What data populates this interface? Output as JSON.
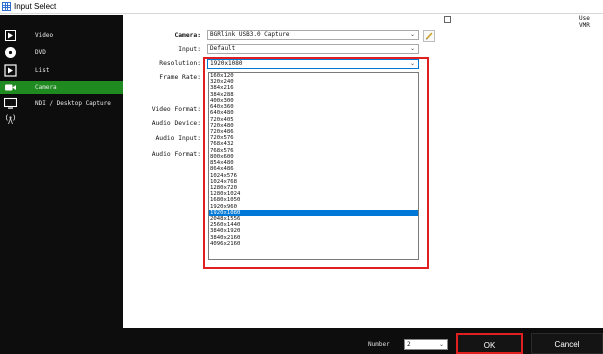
{
  "window": {
    "title": "Input Select"
  },
  "sidebar": {
    "items": [
      {
        "label": "Video",
        "icon": "film-icon",
        "active": false
      },
      {
        "label": "DVD",
        "icon": "disc-icon",
        "active": false
      },
      {
        "label": "List",
        "icon": "playlist-icon",
        "active": false
      },
      {
        "label": "Camera",
        "icon": "camera-icon",
        "active": true
      },
      {
        "label": "NDI / Desktop Capture",
        "icon": "monitor-icon",
        "active": false
      },
      {
        "label": "",
        "icon": "broadcast-antenna-icon",
        "active": false
      }
    ]
  },
  "form": {
    "camera": {
      "label": "Camera:",
      "value": "BGRlink USB3.0 Capture"
    },
    "input": {
      "label": "Input:",
      "value": "Default"
    },
    "resolution": {
      "label": "Resolution:",
      "value": "1920x1080"
    },
    "frame_rate": {
      "label": "Frame Rate:"
    },
    "video_format": {
      "label": "Video Format:"
    },
    "audio_device": {
      "label": "Audio Device:"
    },
    "audio_input": {
      "label": "Audio Input:"
    },
    "audio_format": {
      "label": "Audio Format:"
    },
    "use_vmr": {
      "label": "Use VMR",
      "checked": false
    }
  },
  "resolution_options": [
    "160x120",
    "320x240",
    "384x216",
    "384x288",
    "400x300",
    "640x360",
    "640x480",
    "720x405",
    "720x480",
    "720x486",
    "720x576",
    "768x432",
    "768x576",
    "800x600",
    "854x480",
    "864x486",
    "1024x576",
    "1024x768",
    "1280x720",
    "1280x1024",
    "1680x1050",
    "1920x960",
    "1920x1080",
    "2048x1556",
    "2560x1440",
    "3840x1920",
    "3840x2160",
    "4096x2160"
  ],
  "selected_option_index": 22,
  "footer": {
    "number_label": "Number",
    "number_value": "2",
    "ok_label": "OK",
    "cancel_label": "Cancel"
  },
  "colors": {
    "accent_selected": "#0078d7",
    "sidebar_active": "#1f8a1f",
    "highlight": "#e02020"
  }
}
